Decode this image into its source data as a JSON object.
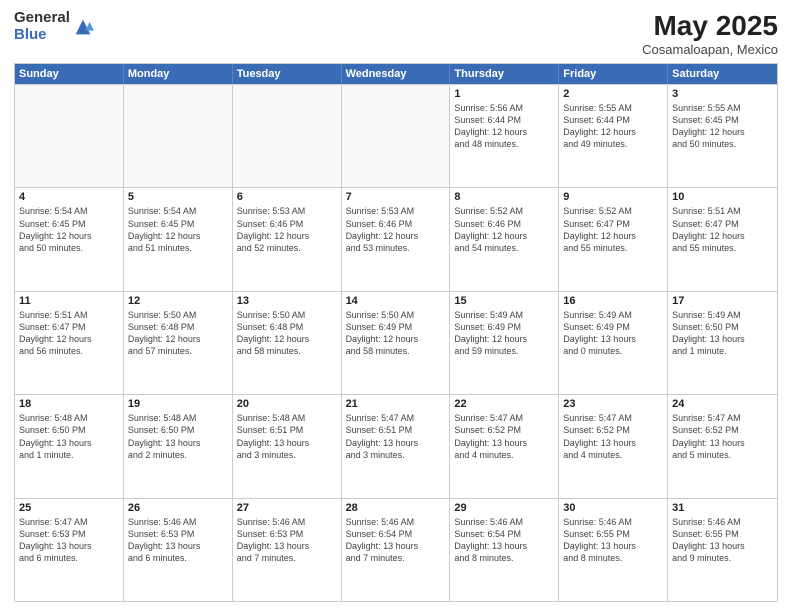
{
  "header": {
    "logo_general": "General",
    "logo_blue": "Blue",
    "title": "May 2025",
    "subtitle": "Cosamaloapan, Mexico"
  },
  "days_of_week": [
    "Sunday",
    "Monday",
    "Tuesday",
    "Wednesday",
    "Thursday",
    "Friday",
    "Saturday"
  ],
  "rows": [
    [
      {
        "day": "",
        "info": ""
      },
      {
        "day": "",
        "info": ""
      },
      {
        "day": "",
        "info": ""
      },
      {
        "day": "",
        "info": ""
      },
      {
        "day": "1",
        "info": "Sunrise: 5:56 AM\nSunset: 6:44 PM\nDaylight: 12 hours\nand 48 minutes."
      },
      {
        "day": "2",
        "info": "Sunrise: 5:55 AM\nSunset: 6:44 PM\nDaylight: 12 hours\nand 49 minutes."
      },
      {
        "day": "3",
        "info": "Sunrise: 5:55 AM\nSunset: 6:45 PM\nDaylight: 12 hours\nand 50 minutes."
      }
    ],
    [
      {
        "day": "4",
        "info": "Sunrise: 5:54 AM\nSunset: 6:45 PM\nDaylight: 12 hours\nand 50 minutes."
      },
      {
        "day": "5",
        "info": "Sunrise: 5:54 AM\nSunset: 6:45 PM\nDaylight: 12 hours\nand 51 minutes."
      },
      {
        "day": "6",
        "info": "Sunrise: 5:53 AM\nSunset: 6:46 PM\nDaylight: 12 hours\nand 52 minutes."
      },
      {
        "day": "7",
        "info": "Sunrise: 5:53 AM\nSunset: 6:46 PM\nDaylight: 12 hours\nand 53 minutes."
      },
      {
        "day": "8",
        "info": "Sunrise: 5:52 AM\nSunset: 6:46 PM\nDaylight: 12 hours\nand 54 minutes."
      },
      {
        "day": "9",
        "info": "Sunrise: 5:52 AM\nSunset: 6:47 PM\nDaylight: 12 hours\nand 55 minutes."
      },
      {
        "day": "10",
        "info": "Sunrise: 5:51 AM\nSunset: 6:47 PM\nDaylight: 12 hours\nand 55 minutes."
      }
    ],
    [
      {
        "day": "11",
        "info": "Sunrise: 5:51 AM\nSunset: 6:47 PM\nDaylight: 12 hours\nand 56 minutes."
      },
      {
        "day": "12",
        "info": "Sunrise: 5:50 AM\nSunset: 6:48 PM\nDaylight: 12 hours\nand 57 minutes."
      },
      {
        "day": "13",
        "info": "Sunrise: 5:50 AM\nSunset: 6:48 PM\nDaylight: 12 hours\nand 58 minutes."
      },
      {
        "day": "14",
        "info": "Sunrise: 5:50 AM\nSunset: 6:49 PM\nDaylight: 12 hours\nand 58 minutes."
      },
      {
        "day": "15",
        "info": "Sunrise: 5:49 AM\nSunset: 6:49 PM\nDaylight: 12 hours\nand 59 minutes."
      },
      {
        "day": "16",
        "info": "Sunrise: 5:49 AM\nSunset: 6:49 PM\nDaylight: 13 hours\nand 0 minutes."
      },
      {
        "day": "17",
        "info": "Sunrise: 5:49 AM\nSunset: 6:50 PM\nDaylight: 13 hours\nand 1 minute."
      }
    ],
    [
      {
        "day": "18",
        "info": "Sunrise: 5:48 AM\nSunset: 6:50 PM\nDaylight: 13 hours\nand 1 minute."
      },
      {
        "day": "19",
        "info": "Sunrise: 5:48 AM\nSunset: 6:50 PM\nDaylight: 13 hours\nand 2 minutes."
      },
      {
        "day": "20",
        "info": "Sunrise: 5:48 AM\nSunset: 6:51 PM\nDaylight: 13 hours\nand 3 minutes."
      },
      {
        "day": "21",
        "info": "Sunrise: 5:47 AM\nSunset: 6:51 PM\nDaylight: 13 hours\nand 3 minutes."
      },
      {
        "day": "22",
        "info": "Sunrise: 5:47 AM\nSunset: 6:52 PM\nDaylight: 13 hours\nand 4 minutes."
      },
      {
        "day": "23",
        "info": "Sunrise: 5:47 AM\nSunset: 6:52 PM\nDaylight: 13 hours\nand 4 minutes."
      },
      {
        "day": "24",
        "info": "Sunrise: 5:47 AM\nSunset: 6:52 PM\nDaylight: 13 hours\nand 5 minutes."
      }
    ],
    [
      {
        "day": "25",
        "info": "Sunrise: 5:47 AM\nSunset: 6:53 PM\nDaylight: 13 hours\nand 6 minutes."
      },
      {
        "day": "26",
        "info": "Sunrise: 5:46 AM\nSunset: 6:53 PM\nDaylight: 13 hours\nand 6 minutes."
      },
      {
        "day": "27",
        "info": "Sunrise: 5:46 AM\nSunset: 6:53 PM\nDaylight: 13 hours\nand 7 minutes."
      },
      {
        "day": "28",
        "info": "Sunrise: 5:46 AM\nSunset: 6:54 PM\nDaylight: 13 hours\nand 7 minutes."
      },
      {
        "day": "29",
        "info": "Sunrise: 5:46 AM\nSunset: 6:54 PM\nDaylight: 13 hours\nand 8 minutes."
      },
      {
        "day": "30",
        "info": "Sunrise: 5:46 AM\nSunset: 6:55 PM\nDaylight: 13 hours\nand 8 minutes."
      },
      {
        "day": "31",
        "info": "Sunrise: 5:46 AM\nSunset: 6:55 PM\nDaylight: 13 hours\nand 9 minutes."
      }
    ]
  ]
}
